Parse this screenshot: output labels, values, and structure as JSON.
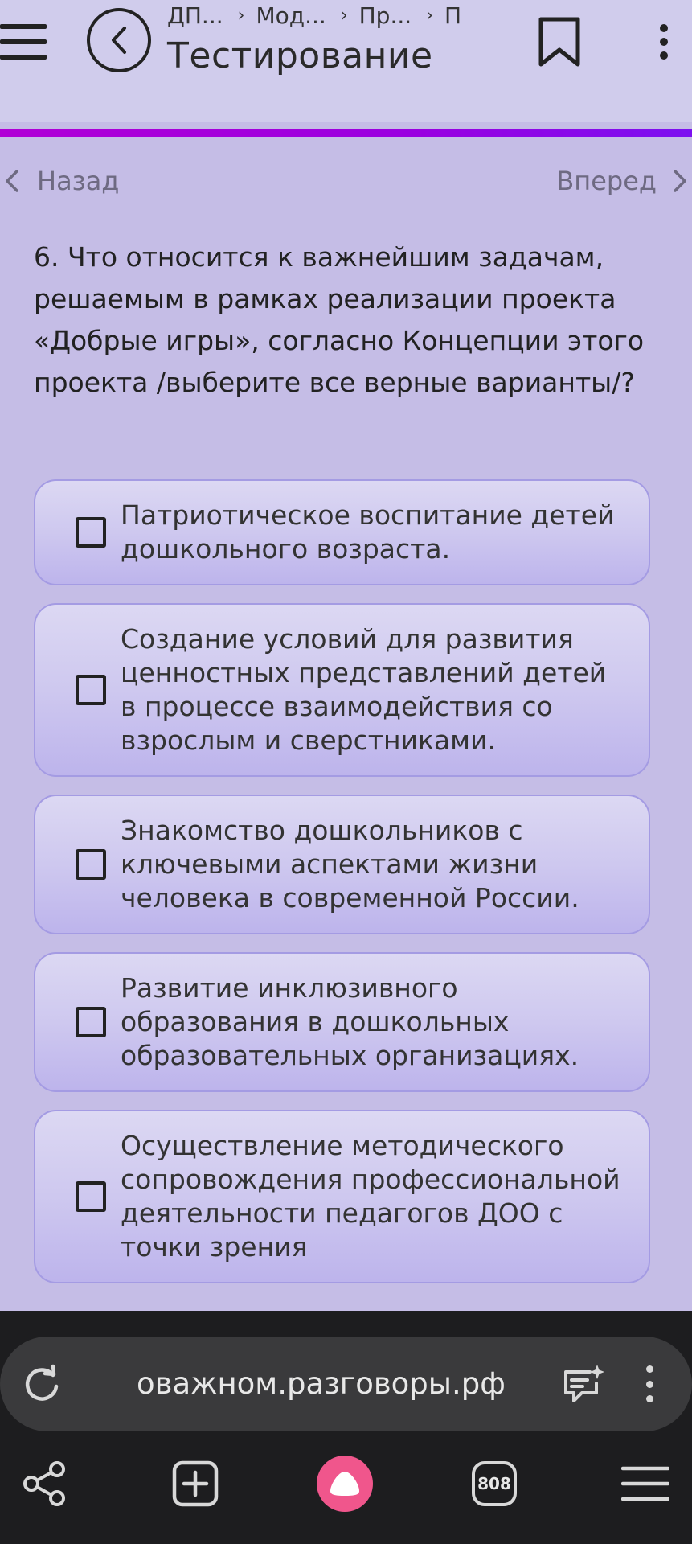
{
  "header": {
    "breadcrumbs": [
      "ДП...",
      "Мод...",
      "Пр...",
      "П"
    ],
    "title": "Тестирование"
  },
  "nav": {
    "prev_label": "Назад",
    "next_label": "Вперед"
  },
  "question": {
    "text": "6.  Что относится к важнейшим задачам, решаемым в рамках реализации проекта «Добрые игры», согласно Концепции этого проекта /выберите все верные варианты/?"
  },
  "options": [
    {
      "text": "Патриотическое воспитание детей дошкольного возраста.",
      "checked": false
    },
    {
      "text": "Создание условий для развития ценностных представлений детей в процессе взаимодействия со взрослым и сверстниками.",
      "checked": false
    },
    {
      "text": "Знакомство дошкольников с ключевыми аспектами жизни человека в современной России.",
      "checked": false
    },
    {
      "text": "Развитие инклюзивного образования в дошкольных образовательных организациях.",
      "checked": false
    },
    {
      "text": "Осуществление методического сопровождения профессиональной деятельности педагогов ДОО с точки зрения",
      "checked": false
    }
  ],
  "browser": {
    "url": "оважном.разговоры.рф",
    "tab_count": "808"
  },
  "colors": {
    "page_bg": "#c5bde6",
    "header_bg": "#d0ccec",
    "accent_strip": "#a500dc",
    "option_border": "#a49be3",
    "browser_bg": "#1d1d1f",
    "alice": "#f0568c"
  }
}
